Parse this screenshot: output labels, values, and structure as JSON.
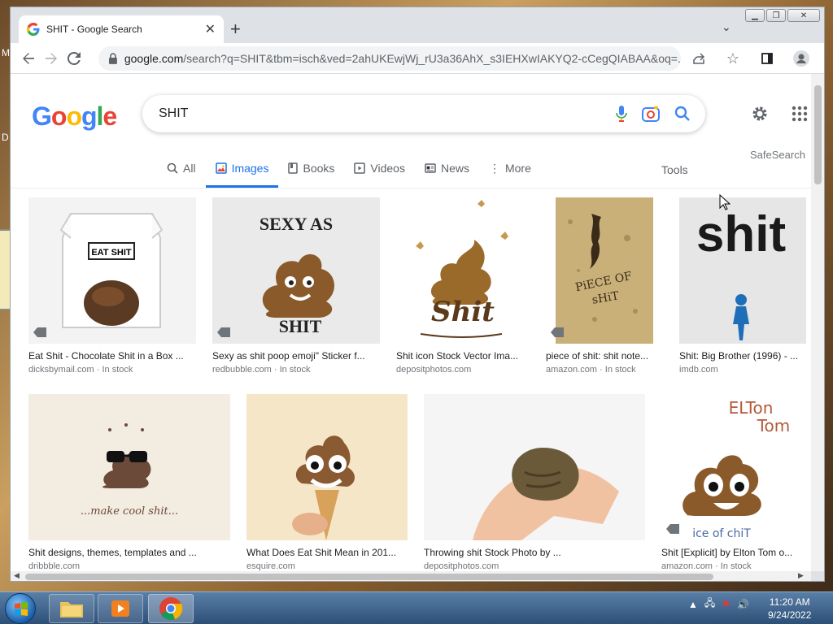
{
  "desktop": {
    "letter_m": "M",
    "letter_d": "D"
  },
  "browser": {
    "tab_title": "SHIT - Google Search",
    "url_main": "google.com",
    "url_rest": "/search?q=SHIT&tbm=isch&ved=2ahUKEwjWj_rU3a36AhX_s3IEHXwIAKYQ2-cCegQIABAA&oq=...",
    "window_controls": [
      "minimize",
      "maximize",
      "close"
    ]
  },
  "google": {
    "logo": "Google",
    "query": "SHIT",
    "nav": [
      {
        "label": "All",
        "icon": "search-icon"
      },
      {
        "label": "Images",
        "icon": "image-icon",
        "active": true
      },
      {
        "label": "Books",
        "icon": "book-icon"
      },
      {
        "label": "Videos",
        "icon": "video-icon"
      },
      {
        "label": "News",
        "icon": "news-icon"
      },
      {
        "label": "More",
        "icon": "more-vert-icon"
      }
    ],
    "tools": "Tools",
    "safesearch": "SafeSearch"
  },
  "results_row1": [
    {
      "title": "Eat Shit - Chocolate Shit in a Box ...",
      "source": "dicksbymail.com",
      "stock": "In stock",
      "img_text": "EAT SHIT"
    },
    {
      "title": "Sexy as shit poop emoji\" Sticker f...",
      "source": "redbubble.com",
      "stock": "In stock",
      "img_text_top": "SEXY AS",
      "img_text_bottom": "SHIT"
    },
    {
      "title": "Shit icon Stock Vector Ima...",
      "source": "depositphotos.com",
      "stock": "",
      "img_text": "Shit"
    },
    {
      "title": "piece of shit: shit note...",
      "source": "amazon.com",
      "stock": "In stock",
      "img_text_top": "PiECE OF",
      "img_text_bottom": "sHiT"
    },
    {
      "title": "Shit: Big Brother (1996) - ...",
      "source": "imdb.com",
      "stock": "",
      "img_text": "shit"
    }
  ],
  "results_row2": [
    {
      "title": "Shit designs, themes, templates and ...",
      "source": "dribbble.com",
      "img_text": "...make cool shit..."
    },
    {
      "title": "What Does Eat Shit Mean in 201...",
      "source": "esquire.com"
    },
    {
      "title": "Throwing shit Stock Photo by ...",
      "source": "depositphotos.com"
    },
    {
      "title": "Shit [Explicit] by Elton Tom o...",
      "source": "amazon.com",
      "stock": "In stock",
      "img_text_top": "ELTon",
      "img_text_mid": "Tom",
      "img_text_bottom": "ice of chiT"
    }
  ],
  "taskbar": {
    "time": "11:20 AM",
    "date": "9/24/2022",
    "apps": [
      "file-explorer",
      "media-player",
      "chrome"
    ]
  },
  "colors": {
    "google_blue": "#4285f4",
    "google_red": "#ea4335",
    "google_yellow": "#fbbc05",
    "google_green": "#34a853",
    "accent": "#1a73e8",
    "poop": "#8b5a2b"
  }
}
